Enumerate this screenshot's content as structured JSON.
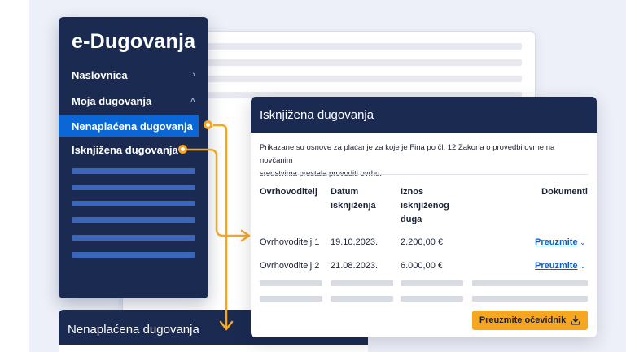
{
  "sidebar": {
    "title": "e-Dugovanja",
    "items": [
      {
        "label": "Naslovnica",
        "chevron": "›"
      },
      {
        "label": "Moja dugovanja",
        "chevron": "˄"
      },
      {
        "label": "Nenaplaćena dugovanja"
      },
      {
        "label": "Isknjižena dugovanja"
      }
    ]
  },
  "card": {
    "title": "Isknjižena dugovanja",
    "description_line1": "Prikazane su osnove za plaćanje za koje je Fina po čl. 12 Zakona o provedbi ovrhe na novčanim",
    "description_line2": "sredstvima prestala provoditi ovrhu.",
    "headers": {
      "creditor": "Ovrhovoditelj",
      "date_line1": "Datum",
      "date_line2": "isknjiženja",
      "amount_line1": "Iznos",
      "amount_line2": "isknjiženog",
      "amount_line3": "duga",
      "documents": "Dokumenti"
    },
    "rows": [
      {
        "creditor": "Ovrhovoditelj 1",
        "date": "19.10.2023.",
        "amount": "2.200,00 €",
        "link": "Preuzmite"
      },
      {
        "creditor": "Ovrhovoditelj 2",
        "date": "21.08.2023.",
        "amount": "6.000,00 €",
        "link": "Preuzmite"
      }
    ],
    "button_label": "Preuzmite očevidnik"
  },
  "bottom_panel": {
    "title": "Nenaplaćena dugovanja"
  },
  "colors": {
    "navy": "#1a2a51",
    "active_blue": "#0b67d6",
    "accent_orange": "#f5a623",
    "link_blue": "#0b5ec9"
  },
  "icons": {
    "dropdown": "chevron-down-icon",
    "download": "download-icon"
  }
}
